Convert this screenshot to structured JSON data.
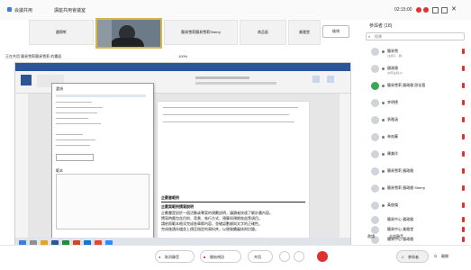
{
  "topbar": {
    "meeting_title": "会議共用",
    "meeting_sub": "講座共用會議室",
    "time_text": "02:15:00"
  },
  "strip": {
    "tiles": [
      "國際軒",
      "",
      "簡易雪莉簡易雪莉Sherry",
      "商品區",
      "美雅堂"
    ],
    "view_label": "檢視"
  },
  "share": {
    "label": "正在共用 簡易雪莉簡易雪莉 的畫面",
    "zoom": "100%"
  },
  "dialog": {
    "title": "選項",
    "section": "範本"
  },
  "document": {
    "heading": "企劃書範例",
    "subheading": "企劃案範例撰寫說明",
    "lines": [
      "企劃書是對於一個活動或專案的規劃說明，讓讀者快速了解計畫內容。",
      "撰寫時應包含目的、背景、執行方式、預算與預期效益等項目。",
      "請依照範本格式完成各章節內容，並確認數據與文字的正確性。",
      "完成後請存檔並上傳至指定的資料夾，以便後續審核與討論。"
    ]
  },
  "panel": {
    "header": "參與者 (18)",
    "search_placeholder": "搜尋",
    "participants": [
      {
        "name": "簡易雪",
        "sub": "(主持人 · 我)"
      },
      {
        "name": "國政雅",
        "sub": "(共同主持人)"
      },
      {
        "name": "簡易雪莉 國政雅 邱佳蓉",
        "sub": ""
      },
      {
        "name": "李明德",
        "sub": ""
      },
      {
        "name": "張雅涵",
        "sub": ""
      },
      {
        "name": "林宛蓁",
        "sub": ""
      },
      {
        "name": "陳美玲",
        "sub": ""
      },
      {
        "name": "簡易雪莉 國政雅",
        "sub": ""
      },
      {
        "name": "簡易雪莉 國政雅 Sherry",
        "sub": ""
      },
      {
        "name": "黃俊傑",
        "sub": ""
      },
      {
        "name": "簡易中心 國政雅",
        "sub": ""
      },
      {
        "name": "簡易中心 美雅堂",
        "sub": ""
      },
      {
        "name": "簡易中心 國政雅",
        "sub": ""
      }
    ],
    "invite_label": "邀請",
    "mute_all_label": "全部靜音"
  },
  "bottombar": {
    "mic_label": "取消靜音",
    "video_label": "開始視訊",
    "share_label": "共用",
    "participants_label": "參與者",
    "leave_label": "離開"
  }
}
